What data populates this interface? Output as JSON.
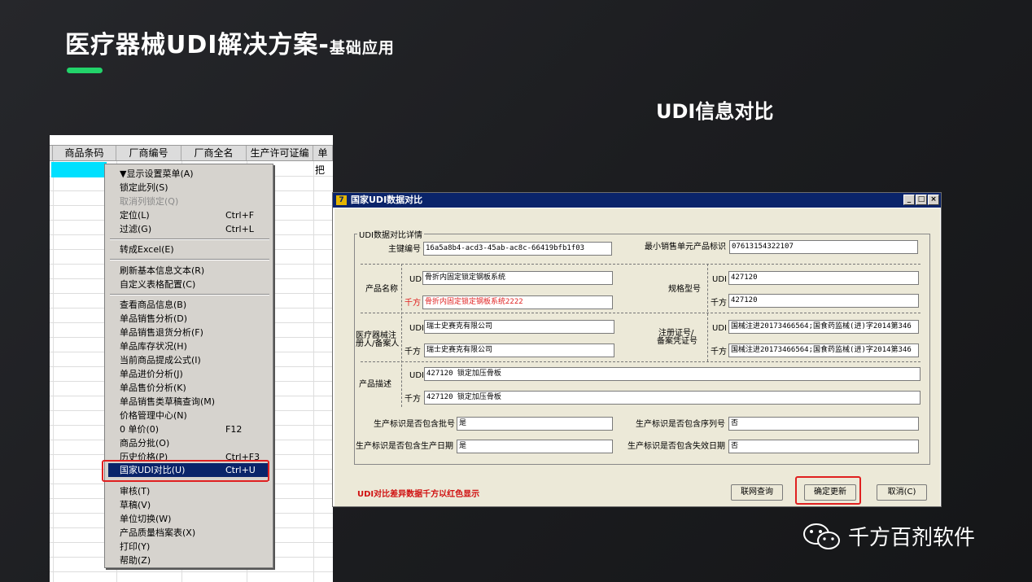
{
  "slide": {
    "title_main": "医疗器械UDI解决方案-",
    "title_sub": "基础应用",
    "section_title": "UDI信息对比"
  },
  "grid": {
    "headers": [
      "商品条码",
      "厂商编号",
      "厂商全名",
      "生产许可证编",
      "单"
    ],
    "cell_ba": "把"
  },
  "menu": {
    "items": [
      {
        "label": "▼显示设置菜单(A)"
      },
      {
        "label": "锁定此列(S)"
      },
      {
        "label": "取消列锁定(Q)",
        "disabled": true
      },
      {
        "label": "定位(L)",
        "shortcut": "Ctrl+F"
      },
      {
        "label": "过滤(G)",
        "shortcut": "Ctrl+L"
      },
      {
        "label": "转成Excel(E)"
      },
      {
        "label": "刷新基本信息文本(R)"
      },
      {
        "label": "自定义表格配置(C)"
      },
      {
        "label": "查看商品信息(B)"
      },
      {
        "label": "单品销售分析(D)"
      },
      {
        "label": "单品销售退货分析(F)"
      },
      {
        "label": "单品库存状况(H)"
      },
      {
        "label": "当前商品提成公式(I)"
      },
      {
        "label": "单品进价分析(J)"
      },
      {
        "label": "单品售价分析(K)"
      },
      {
        "label": "单品销售类草稿查询(M)"
      },
      {
        "label": "价格管理中心(N)"
      },
      {
        "label": "0 单价(0)",
        "shortcut": "F12"
      },
      {
        "label": "商品分批(O)"
      },
      {
        "label": "历史价格(P)",
        "shortcut": "Ctrl+F3"
      },
      {
        "label": "国家UDI对比(U)",
        "shortcut": "Ctrl+U",
        "selected": true
      },
      {
        "label": "审核(T)"
      },
      {
        "label": "草稿(V)"
      },
      {
        "label": "单位切换(W)"
      },
      {
        "label": "产品质量档案表(X)"
      },
      {
        "label": "打印(Y)"
      },
      {
        "label": "帮助(Z)"
      }
    ]
  },
  "dialog": {
    "title": "国家UDI数据对比",
    "logo": "7",
    "win_buttons": [
      "_",
      "□",
      "×"
    ],
    "group_label": "UDI数据对比详情",
    "primary_key_label": "主键编号",
    "primary_key_value": "16a5a8b4-acd3-45ab-ac8c-66419bfb1f03",
    "min_unit_label": "最小销售单元产品标识",
    "min_unit_value": "07613154322107",
    "product_name_label": "产品名称",
    "spec_label": "规格型号",
    "registrant_label_1": "医疗器械注",
    "registrant_label_2": "册人/备案人",
    "reg_no_label_1": "注册证号/",
    "reg_no_label_2": "备案凭证号",
    "desc_label": "产品描述",
    "udi_tag": "UDI",
    "qf_tag": "千方",
    "product_name_udi": "骨折内固定锁定钢板系统",
    "product_name_qf": "骨折内固定锁定钢板系统2222",
    "spec_udi": "427120",
    "spec_qf": "427120",
    "registrant_udi": "瑞士史赛克有限公司",
    "registrant_qf": "瑞士史赛克有限公司",
    "reg_no_udi": "国械注进20173466564;国食药监械(进)字2014第346",
    "reg_no_qf": "国械注进20173466564;国食药监械(进)字2014第346",
    "desc_udi": "427120 锁定加压骨板",
    "desc_qf": "427120 锁定加压骨板",
    "batch_label": "生产标识是否包含批号",
    "batch_value": "是",
    "serial_label": "生产标识是否包含序列号",
    "serial_value": "否",
    "mfg_date_label": "生产标识是否包含生产日期",
    "mfg_date_value": "是",
    "exp_date_label": "生产标识是否包含失效日期",
    "exp_date_value": "否",
    "note": "UDI对比差异数据千方以红色显示",
    "btn_query": "联网查询",
    "btn_confirm": "确定更新",
    "btn_cancel": "取消(C)"
  },
  "watermark": {
    "text": "千方百剂软件"
  },
  "colors": {
    "accent_green": "#22d36a",
    "highlight_red": "#e02020",
    "menu_selected": "#0a246a",
    "grid_selected": "#00e0ff"
  }
}
